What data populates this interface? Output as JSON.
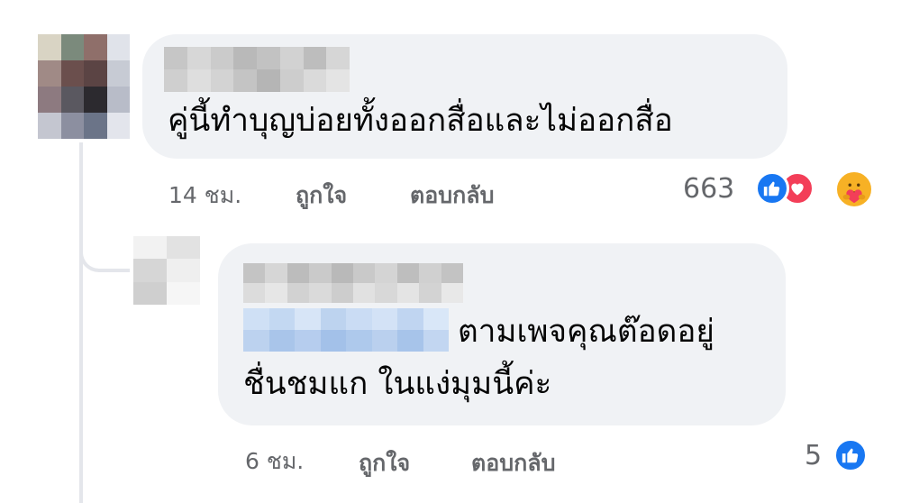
{
  "comment": {
    "text": "คู่นี้ทำบุญบ่อยทั้งออกสื่อและไม่ออกสื่อ",
    "time": "14 ชม.",
    "like_label": "ถูกใจ",
    "reply_label": "ตอบกลับ",
    "reaction_count": "663",
    "reactions": [
      "like-icon",
      "love-icon",
      "care-icon"
    ]
  },
  "reply": {
    "text_line1": "ตามเพจคุณต๊อดอยู่",
    "text_line2": "ชื่นชมแก ในแง่มุมนี้ค่ะ",
    "time": "6 ชม.",
    "like_label": "ถูกใจ",
    "reply_label": "ตอบกลับ",
    "reaction_count": "5",
    "reactions": [
      "like-icon"
    ]
  },
  "colors": {
    "bubble": "#f0f2f5",
    "meta_text": "#65676b",
    "like_blue": "#1877f2",
    "love_red": "#f33e58",
    "care_yellow": "#f7b125"
  }
}
